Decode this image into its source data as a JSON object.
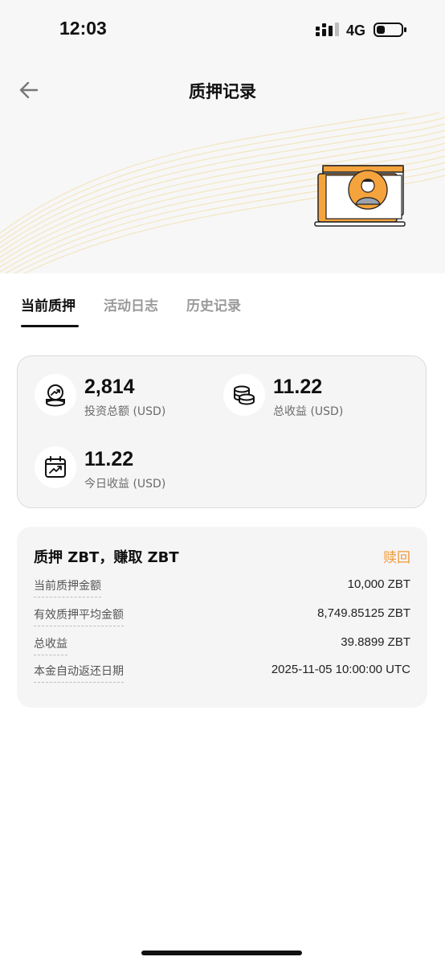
{
  "status_bar": {
    "time": "12:03",
    "network": "4G"
  },
  "header": {
    "title": "质押记录"
  },
  "tabs": [
    {
      "label": "当前质押",
      "active": true
    },
    {
      "label": "活动日志",
      "active": false
    },
    {
      "label": "历史记录",
      "active": false
    }
  ],
  "summary": {
    "investment": {
      "value": "2,814",
      "label": "投资总额 (USD)",
      "icon": "investment-icon"
    },
    "total_earnings": {
      "value": "11.22",
      "label": "总收益 (USD)",
      "icon": "coins-icon"
    },
    "today_earnings": {
      "value": "11.22",
      "label": "今日收益 (USD)",
      "icon": "calendar-chart-icon"
    }
  },
  "stake": {
    "title": "质押 ZBT，赚取 ZBT",
    "redeem_label": "赎回",
    "rows": [
      {
        "label": "当前质押金额",
        "value": "10,000 ZBT"
      },
      {
        "label": "有效质押平均金额",
        "value": "8,749.85125 ZBT"
      },
      {
        "label": "总收益",
        "value": "39.8899 ZBT"
      },
      {
        "label": "本金自动返还日期",
        "value": "2025-11-05 10:00:00 UTC"
      }
    ]
  },
  "colors": {
    "accent": "#f09a38",
    "card_bg": "#f5f5f6",
    "text": "#111111",
    "muted": "#9a9a9a"
  }
}
